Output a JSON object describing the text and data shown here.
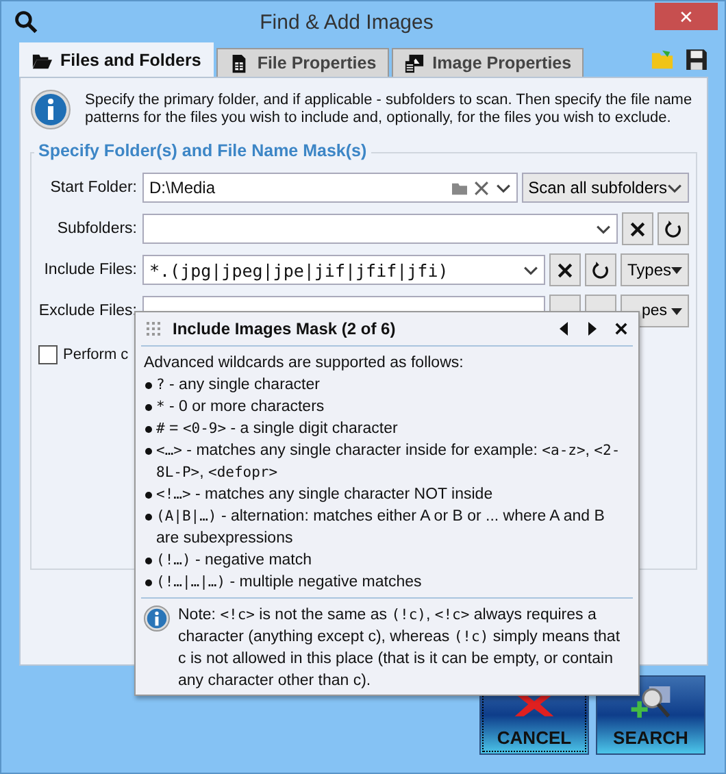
{
  "window": {
    "title": "Find & Add Images",
    "close": "✕"
  },
  "tabs": [
    {
      "label": "Files and Folders",
      "selected": true,
      "kind": "folder"
    },
    {
      "label": "File Properties",
      "selected": false,
      "kind": "doc"
    },
    {
      "label": "Image Properties",
      "selected": false,
      "kind": "image"
    }
  ],
  "info": "Specify the primary folder, and if applicable - subfolders to scan. Then specify the file name patterns for the files you wish to include and, optionally, for the files you wish to exclude.",
  "group_title": "Specify Folder(s) and File Name Mask(s)",
  "start_folder": {
    "label": "Start Folder:",
    "value": "D:\\Media",
    "scan": "Scan all subfolders"
  },
  "subfolders": {
    "label": "Subfolders:"
  },
  "include_files": {
    "label": "Include Files:",
    "value": "*.(jpg|jpeg|jpe|jif|jfif|jfi)",
    "types": "Types"
  },
  "exclude_files": {
    "label": "Exclude Files:",
    "types": "pes"
  },
  "perform": {
    "label": "Perform c",
    "checked": false
  },
  "popup": {
    "title": "Include Images Mask (2 of 6)",
    "intro": "Advanced wildcards are supported as follows:",
    "items": [
      [
        {
          "kind": "code",
          "text": "?"
        },
        {
          "kind": "plain",
          "text": " - any single character"
        }
      ],
      [
        {
          "kind": "code",
          "text": "*"
        },
        {
          "kind": "plain",
          "text": " - 0 or more characters"
        }
      ],
      [
        {
          "kind": "code",
          "text": "#"
        },
        {
          "kind": "plain",
          "text": " = "
        },
        {
          "kind": "code",
          "text": "<0-9>"
        },
        {
          "kind": "plain",
          "text": " - a single digit character"
        }
      ],
      [
        {
          "kind": "code",
          "text": "<…>"
        },
        {
          "kind": "plain",
          "text": " - matches any single character inside for example: "
        },
        {
          "kind": "code",
          "text": "<a-z>"
        },
        {
          "kind": "plain",
          "text": ", "
        },
        {
          "kind": "code",
          "text": "<2-8L-P>"
        },
        {
          "kind": "plain",
          "text": ", "
        },
        {
          "kind": "code",
          "text": "<defopr>"
        }
      ],
      [
        {
          "kind": "code",
          "text": "<!…>"
        },
        {
          "kind": "plain",
          "text": " - matches any single character NOT inside"
        }
      ],
      [
        {
          "kind": "code",
          "text": "(A|B|…)"
        },
        {
          "kind": "plain",
          "text": " - alternation: matches either A or B or ... where A and B are subexpressions"
        }
      ],
      [
        {
          "kind": "code",
          "text": "(!…)"
        },
        {
          "kind": "plain",
          "text": " - negative match"
        }
      ],
      [
        {
          "kind": "code",
          "text": "(!…|…|…)"
        },
        {
          "kind": "plain",
          "text": " - multiple negative matches"
        }
      ]
    ],
    "note": [
      {
        "kind": "plain",
        "text": "Note: "
      },
      {
        "kind": "code",
        "text": "<!c>"
      },
      {
        "kind": "plain",
        "text": " is not the same as "
      },
      {
        "kind": "code",
        "text": "(!c)"
      },
      {
        "kind": "plain",
        "text": ", "
      },
      {
        "kind": "code",
        "text": "<!c>"
      },
      {
        "kind": "plain",
        "text": " always requires a character (anything except c), whereas "
      },
      {
        "kind": "code",
        "text": "(!c)"
      },
      {
        "kind": "plain",
        "text": " simply means that c is not allowed in this place (that is it can be empty, or contain any character other than c)."
      }
    ]
  },
  "buttons": [
    {
      "label": "CANCEL",
      "kind": "cancel"
    },
    {
      "label": "SEARCH",
      "kind": "search"
    }
  ]
}
